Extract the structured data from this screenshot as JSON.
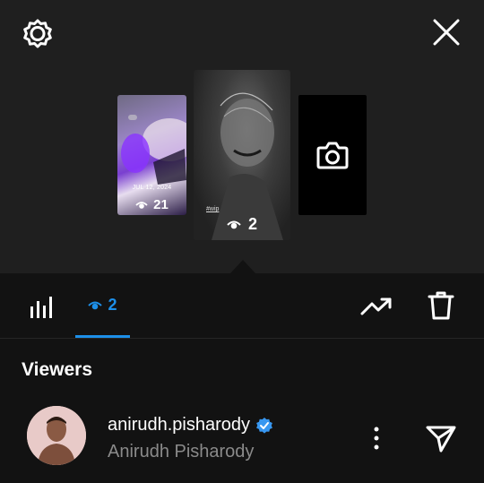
{
  "stories": {
    "left": {
      "date_text": "JUL 12, 2024",
      "view_count": "21"
    },
    "middle": {
      "tag_text": "#wip",
      "view_count": "2"
    }
  },
  "tabs": {
    "viewers_count": "2"
  },
  "viewers_section": {
    "title": "Viewers",
    "items": [
      {
        "username": "anirudh.pisharody",
        "full_name": "Anirudh Pisharody",
        "verified": true
      }
    ]
  },
  "colors": {
    "accent": "#1d8fe8",
    "verified": "#3897f0",
    "bottom_bg": "#121212",
    "top_bg": "#1f1f1f"
  },
  "icons": [
    "settings-icon",
    "close-icon",
    "camera-icon",
    "eye-icon",
    "bar-chart-icon",
    "trending-up-icon",
    "trash-icon",
    "more-vertical-icon",
    "send-icon",
    "verified-badge-icon"
  ]
}
